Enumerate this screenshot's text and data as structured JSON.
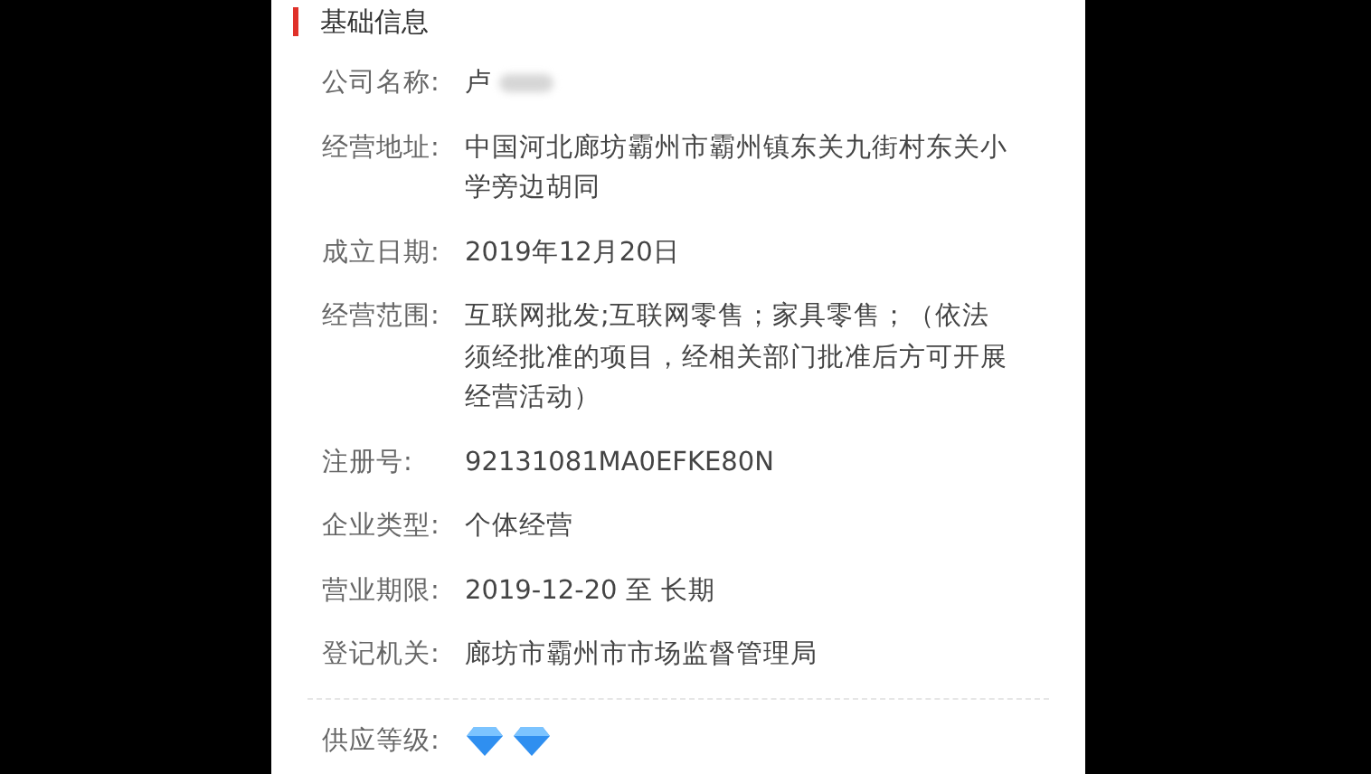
{
  "section": {
    "title": "基础信息"
  },
  "fields": [
    {
      "label": "公司名称:",
      "value": "卢",
      "redacted": true
    },
    {
      "label": "经营地址:",
      "value": "中国河北廊坊霸州市霸州镇东关九街村东关小学旁边胡同",
      "redacted": false
    },
    {
      "label": "成立日期:",
      "value": "2019年12月20日",
      "redacted": false
    },
    {
      "label": "经营范围:",
      "value": "互联网批发;互联网零售；家具零售；（依法须经批准的项目，经相关部门批准后方可开展经营活动）",
      "redacted": false
    },
    {
      "label": "注册号:",
      "value": "92131081MA0EFKE80N",
      "redacted": false
    },
    {
      "label": "企业类型:",
      "value": "个体经营",
      "redacted": false
    },
    {
      "label": "营业期限:",
      "value": "2019-12-20 至 长期",
      "redacted": false
    },
    {
      "label": "登记机关:",
      "value": "廊坊市霸州市市场监督管理局",
      "redacted": false
    }
  ],
  "supply_level": {
    "label": "供应等级:",
    "stars": 2
  }
}
